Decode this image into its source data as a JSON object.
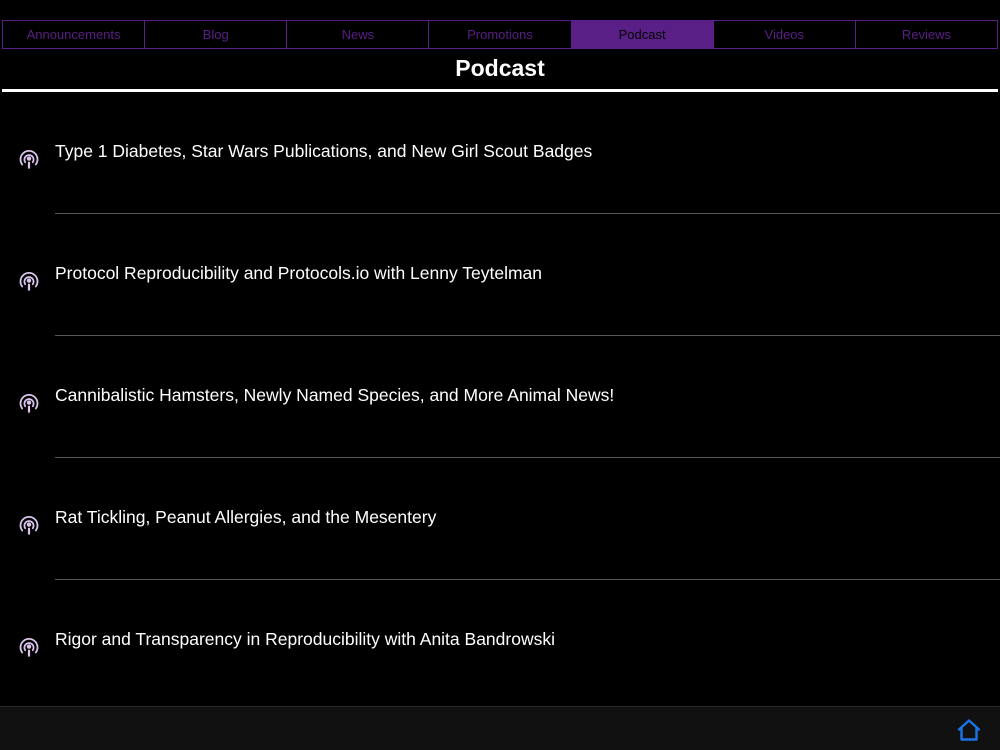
{
  "tabs": [
    {
      "label": "Announcements",
      "active": false
    },
    {
      "label": "Blog",
      "active": false
    },
    {
      "label": "News",
      "active": false
    },
    {
      "label": "Promotions",
      "active": false
    },
    {
      "label": "Podcast",
      "active": true
    },
    {
      "label": "Videos",
      "active": false
    },
    {
      "label": "Reviews",
      "active": false
    }
  ],
  "page_title": "Podcast",
  "episodes": [
    {
      "title": "Type 1 Diabetes, Star Wars Publications, and New Girl Scout Badges",
      "icon": "podcast-icon"
    },
    {
      "title": "Protocol Reproducibility and Protocols.io with Lenny Teytelman",
      "icon": "podcast-icon"
    },
    {
      "title": "Cannibalistic Hamsters, Newly Named Species, and More Animal News!",
      "icon": "podcast-icon"
    },
    {
      "title": "Rat Tickling, Peanut Allergies, and the Mesentery",
      "icon": "podcast-icon"
    },
    {
      "title": "Rigor and Transparency in Reproducibility with Anita Bandrowski",
      "icon": "podcast-icon"
    }
  ],
  "bottom_bar": {
    "home_icon": "home-icon"
  },
  "colors": {
    "accent": "#5a1f86",
    "background": "#000000",
    "text": "#ffffff",
    "home_icon": "#1a73e8",
    "podcast_icon": "#d9c4ec"
  }
}
